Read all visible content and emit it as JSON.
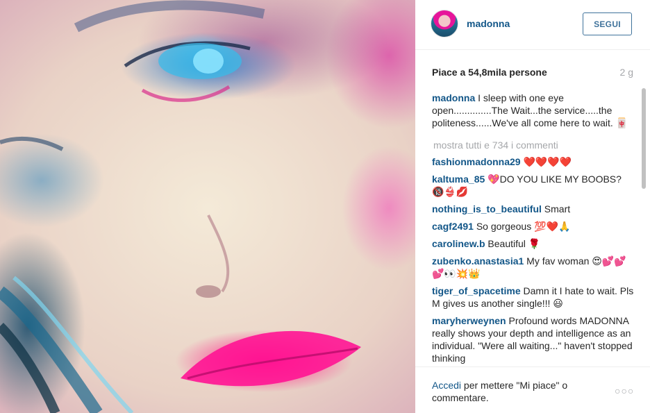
{
  "post": {
    "image_icon": "portrait-photo"
  },
  "header": {
    "username": "madonna",
    "follow_label": "SEGUI"
  },
  "stats": {
    "likes": "Piace a 54,8mila persone",
    "time": "2 g"
  },
  "caption": {
    "user": "madonna",
    "text": "I sleep with one eye open..............The Wait...the service.....the politeness......We've all come here to wait. 🀄"
  },
  "load_more": "mostra tutti e 734 i commenti",
  "comments": [
    {
      "user": "fashionmadonna29",
      "text": "❤️❤️❤️❤️"
    },
    {
      "user": "kaltuma_85",
      "text": "💖DO YOU LIKE MY BOOBS? 🔞👙💋"
    },
    {
      "user": "nothing_is_to_beautiful",
      "text": "Smart"
    },
    {
      "user": "cagf2491",
      "text": "So gorgeous 💯❤️🙏"
    },
    {
      "user": "carolinew.b",
      "text": "Beautiful 🌹"
    },
    {
      "user": "zubenko.anastasia1",
      "text": "My fav woman 😍💕💕💕👀💥👑"
    },
    {
      "user": "tiger_of_spacetime",
      "text": "Damn it I hate to wait. Pls M gives us another single!!! 😃"
    },
    {
      "user": "maryherweynen",
      "text": "Profound words MADONNA really shows your depth and intelligence as an individual. \"Were all waiting...\" haven't stopped thinking"
    }
  ],
  "footer": {
    "login_link": "Accedi",
    "login_text": " per mettere \"Mi piace\" o commentare.",
    "more_label": "○○○"
  },
  "colors": {
    "link": "#125688",
    "button": "#3f729b",
    "muted": "#a5a7aa"
  }
}
